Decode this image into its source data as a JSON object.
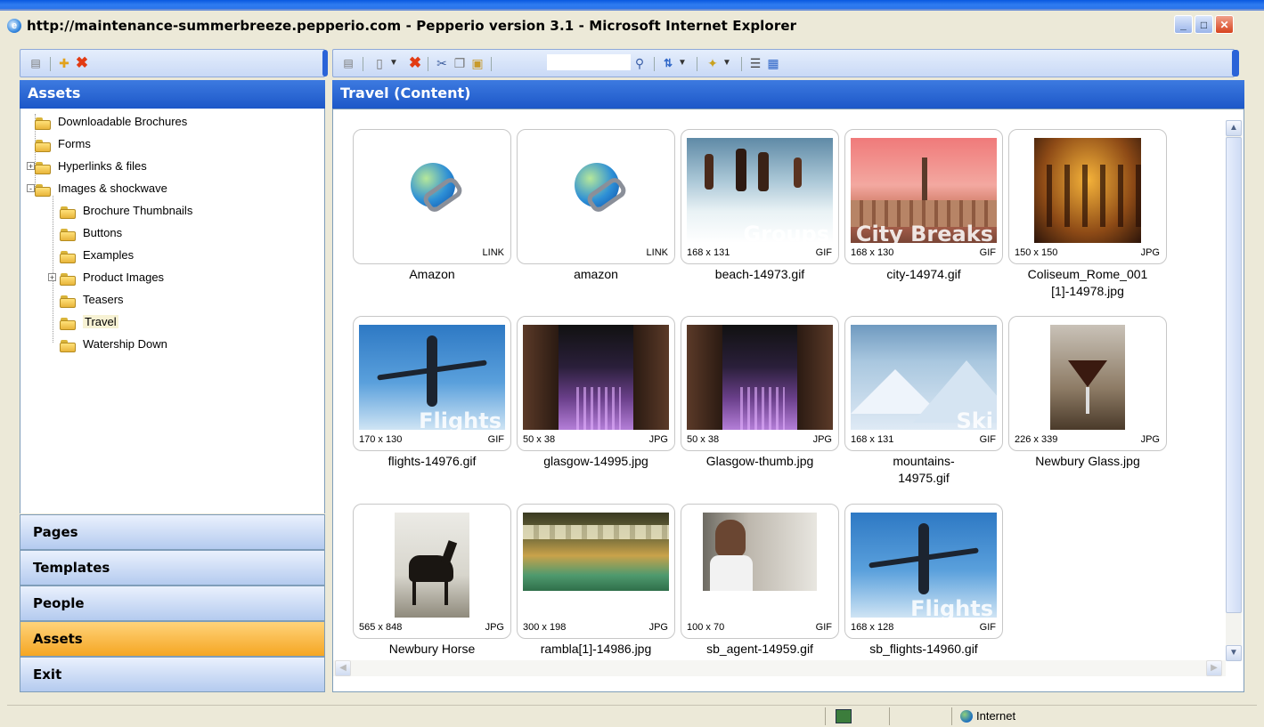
{
  "window": {
    "title": "http://maintenance-summerbreeze.pepperio.com - Pepperio version 3.1 - Microsoft Internet Explorer",
    "controls": [
      "minimize",
      "maximize",
      "close"
    ]
  },
  "left_panel": {
    "header": "Assets",
    "toolbar_icons": [
      "properties-icon",
      "new-folder-icon",
      "delete-icon"
    ],
    "tree": [
      {
        "label": "Downloadable Brochures",
        "level": 0,
        "expander": ""
      },
      {
        "label": "Forms",
        "level": 0,
        "expander": ""
      },
      {
        "label": "Hyperlinks & files",
        "level": 0,
        "expander": "+"
      },
      {
        "label": "Images & shockwave",
        "level": 0,
        "expander": "-"
      },
      {
        "label": "Brochure Thumbnails",
        "level": 1,
        "expander": ""
      },
      {
        "label": "Buttons",
        "level": 1,
        "expander": ""
      },
      {
        "label": "Examples",
        "level": 1,
        "expander": ""
      },
      {
        "label": "Product Images",
        "level": 1,
        "expander": "+"
      },
      {
        "label": "Teasers",
        "level": 1,
        "expander": ""
      },
      {
        "label": "Travel",
        "level": 1,
        "expander": "",
        "selected": true
      },
      {
        "label": "Watership Down",
        "level": 1,
        "expander": ""
      }
    ],
    "nav": [
      {
        "label": "Pages",
        "active": false
      },
      {
        "label": "Templates",
        "active": false
      },
      {
        "label": "People",
        "active": false
      },
      {
        "label": "Assets",
        "active": true
      },
      {
        "label": "Exit",
        "active": false
      }
    ]
  },
  "content": {
    "header": "Travel (Content)",
    "search": {
      "value": "",
      "placeholder": ""
    },
    "toolbar_icons": [
      "properties-icon",
      "new-icon",
      "dropdown-icon",
      "delete-icon",
      "cut-icon",
      "copy-icon",
      "paste-icon",
      "search-icon",
      "sort-icon",
      "dropdown-icon",
      "magic-icon",
      "dropdown-icon",
      "details-view-icon",
      "thumbnail-view-icon"
    ],
    "assets": [
      {
        "name": "Amazon",
        "dims": "",
        "type": "LINK",
        "kind": "link"
      },
      {
        "name": "amazon",
        "dims": "",
        "type": "LINK",
        "kind": "link"
      },
      {
        "name": "beach-14973.gif",
        "dims": "168 x 131",
        "type": "GIF",
        "kind": "beach",
        "overlay": "Groups"
      },
      {
        "name": "city-14974.gif",
        "dims": "168 x 130",
        "type": "GIF",
        "kind": "city",
        "overlay": "City Breaks"
      },
      {
        "name": "Coliseum_Rome_001[1]-14978.jpg",
        "name_line1": "Coliseum_Rome_001",
        "name_line2": "[1]-14978.jpg",
        "dims": "150 x 150",
        "type": "JPG",
        "kind": "coliseum"
      },
      {
        "name": "flights-14976.gif",
        "dims": "170 x 130",
        "type": "GIF",
        "kind": "flights",
        "overlay": "Flights"
      },
      {
        "name": "glasgow-14995.jpg",
        "dims": "50 x 38",
        "type": "JPG",
        "kind": "glasgow"
      },
      {
        "name": "Glasgow-thumb.jpg",
        "dims": "50 x 38",
        "type": "JPG",
        "kind": "glasgow"
      },
      {
        "name": "mountains-14975.gif",
        "name_line1": "mountains-",
        "name_line2": "14975.gif",
        "dims": "168 x 131",
        "type": "GIF",
        "kind": "mountains",
        "overlay": "Ski"
      },
      {
        "name": "Newbury Glass.jpg",
        "dims": "226 x 339",
        "type": "JPG",
        "kind": "glass"
      },
      {
        "name": "Newbury Horse",
        "dims": "565 x 848",
        "type": "JPG",
        "kind": "horse"
      },
      {
        "name": "rambla[1]-14986.jpg",
        "dims": "300 x 198",
        "type": "JPG",
        "kind": "rambla"
      },
      {
        "name": "sb_agent-14959.gif",
        "dims": "100 x 70",
        "type": "GIF",
        "kind": "agent"
      },
      {
        "name": "sb_flights-14960.gif",
        "dims": "168 x 128",
        "type": "GIF",
        "kind": "flights",
        "overlay": "Flights"
      }
    ]
  },
  "statusbar": {
    "zone": "Internet"
  },
  "colors": {
    "header_blue": "#1d57c8",
    "active_nav": "#f5a623",
    "toolbar_bg": "#d6e3f8"
  }
}
